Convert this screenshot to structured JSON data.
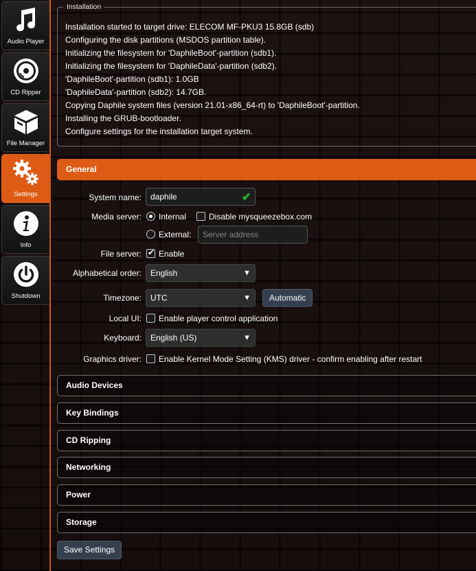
{
  "sidebar": {
    "items": [
      {
        "label": "Audio Player",
        "icon": "music-note-icon",
        "active": false
      },
      {
        "label": "CD Ripper",
        "icon": "disc-icon",
        "active": false
      },
      {
        "label": "File Manager",
        "icon": "box-icon",
        "active": false
      },
      {
        "label": "Settings",
        "icon": "gears-icon",
        "active": true
      },
      {
        "label": "Info",
        "icon": "info-icon",
        "active": false
      },
      {
        "label": "Shutdown",
        "icon": "power-icon",
        "active": false
      }
    ]
  },
  "installation": {
    "legend": "Installation",
    "lines": [
      "Installation started to target drive: ELECOM MF-PKU3 15.8GB (sdb)",
      "Configuring the disk partitions (MSDOS partition table).",
      "Initializing the filesystem for 'DaphileBoot'-partition (sdb1).",
      "Initializing the filesystem for 'DaphileData'-partition (sdb2).",
      "'DaphileBoot'-partition (sdb1): 1.0GB",
      "'DaphileData'-partition (sdb2): 14.7GB.",
      "Copying Daphile system files (version 21.01-x86_64-rt) to 'DaphileBoot'-partition.",
      "Installing the GRUB-bootloader.",
      "Configure settings for the installation target system."
    ]
  },
  "general": {
    "title": "General",
    "system_name": {
      "label": "System name:",
      "value": "daphile"
    },
    "media_server": {
      "label": "Media server:",
      "internal_label": "Internal",
      "disable_label": "Disable mysqueezebox.com",
      "external_label": "External:",
      "address_placeholder": "Server address"
    },
    "file_server": {
      "label": "File server:",
      "enable_label": "Enable"
    },
    "alphabetical_order": {
      "label": "Alphabetical order:",
      "value": "English"
    },
    "timezone": {
      "label": "Timezone:",
      "value": "UTC",
      "button": "Automatic"
    },
    "local_ui": {
      "label": "Local UI:",
      "option_label": "Enable player control application"
    },
    "keyboard": {
      "label": "Keyboard:",
      "value": "English (US)"
    },
    "graphics_driver": {
      "label": "Graphics driver:",
      "option_label": "Enable Kernel Mode Setting (KMS) driver - confirm enabling after restart"
    }
  },
  "sections": [
    "Audio Devices",
    "Key Bindings",
    "CD Ripping",
    "Networking",
    "Power",
    "Storage"
  ],
  "save_button": "Save Settings",
  "colors": {
    "accent": "#dd5b15",
    "success": "#2ea82e"
  }
}
